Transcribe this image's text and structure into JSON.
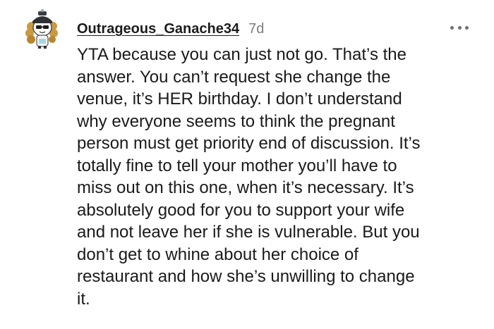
{
  "comment": {
    "author": {
      "username": "Outrageous_Ganache34",
      "avatar_icon": "snoo-avatar-icon"
    },
    "timestamp": "7d",
    "more_menu_icon": "more-options-icon",
    "body": "YTA because you can just not go. That’s the\nanswer. You can’t request she change the\nvenue, it’s HER birthday. I don’t understand\nwhy everyone seems to think the pregnant\nperson must get priority end of discussion. It’s\ntotally fine to tell your mother you’ll have to\nmiss out on this one, when it’s necessary. It’s\nabsolutely good for you to support your wife\nand not leave her if she is vulnerable. But you\ndon’t get to whine about her choice of\nrestaurant and how she’s unwilling to change\nit."
  },
  "colors": {
    "background": "#ffffff",
    "text": "#1a1a1b",
    "meta": "#7c7c7c"
  }
}
